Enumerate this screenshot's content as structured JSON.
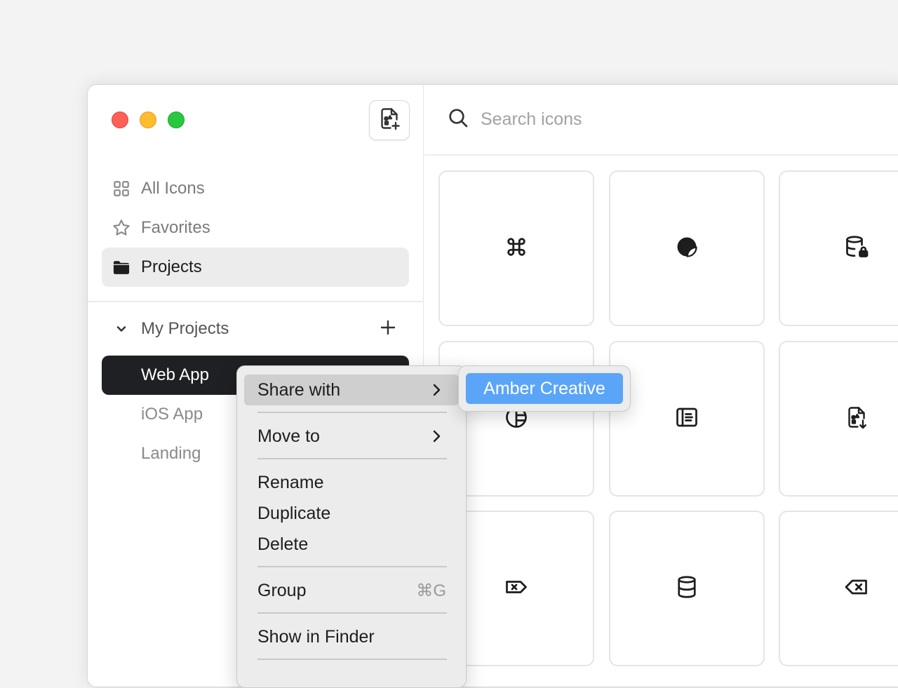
{
  "sidebar": {
    "nav": [
      {
        "label": "All Icons",
        "icon": "grid-icon"
      },
      {
        "label": "Favorites",
        "icon": "star-icon"
      },
      {
        "label": "Projects",
        "icon": "folder-icon",
        "active": true
      }
    ],
    "section_title": "My Projects",
    "projects": [
      {
        "label": "Web App",
        "selected": true
      },
      {
        "label": "iOS App"
      },
      {
        "label": "Landing"
      }
    ]
  },
  "search": {
    "placeholder": "Search icons"
  },
  "icon_tiles": [
    "command-icon",
    "sticker-icon",
    "database-lock-icon",
    "chart-pie-icon",
    "sidebar-list-icon",
    "file-shapes-download-icon",
    "tag-x-icon",
    "database-icon",
    "backspace-icon"
  ],
  "context_menu": {
    "share_with": "Share with",
    "move_to": "Move to",
    "rename": "Rename",
    "duplicate": "Duplicate",
    "delete": "Delete",
    "group": "Group",
    "group_shortcut": "⌘G",
    "show_in_finder": "Show in Finder"
  },
  "submenu": {
    "item": "Amber Creative"
  },
  "colors": {
    "accent": "#5aa5f8",
    "selected_bg": "#1f2023",
    "close": "#fe5f57",
    "minimize": "#febc2e",
    "zoom": "#28c840"
  }
}
